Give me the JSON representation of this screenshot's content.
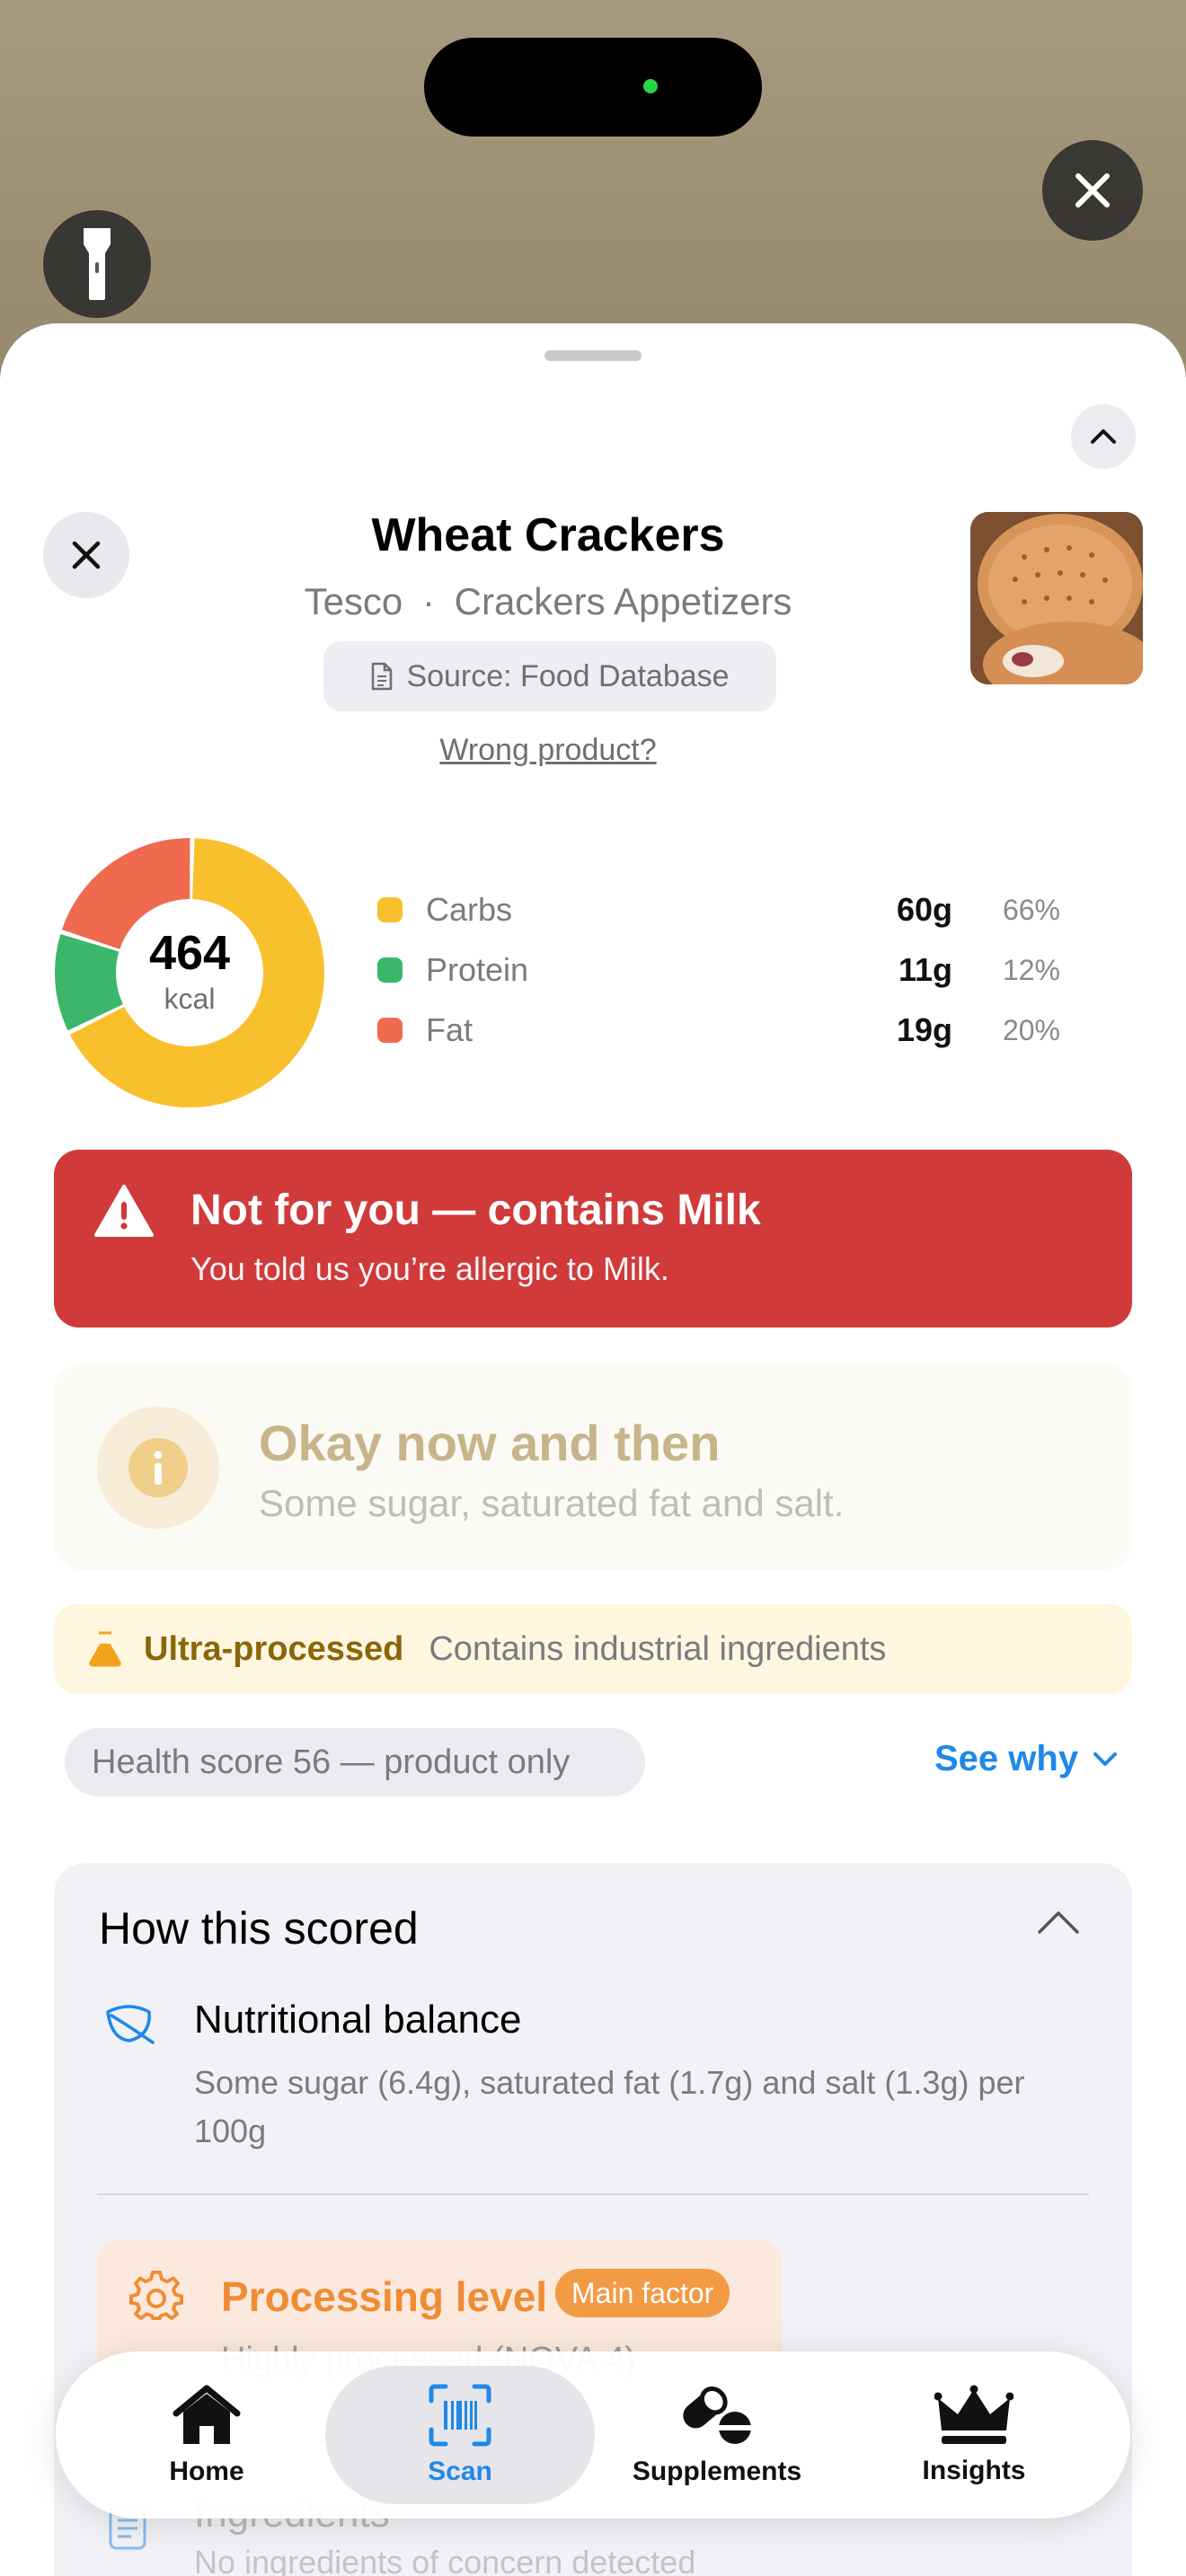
{
  "product": {
    "name": "Wheat Crackers",
    "brand": "Tesco",
    "separator": "·",
    "category": "Crackers Appetizers",
    "source": "Source: Food Database",
    "wrong_product": "Wrong product?"
  },
  "nutrition": {
    "kcal": "464",
    "kcal_unit": "kcal",
    "macros": [
      {
        "name": "Carbs",
        "grams": "60g",
        "percent": "66%",
        "fraction": 0.66,
        "color": "#f9c02e"
      },
      {
        "name": "Protein",
        "grams": "11g",
        "percent": "12%",
        "fraction": 0.12,
        "color": "#3cb66a"
      },
      {
        "name": "Fat",
        "grams": "19g",
        "percent": "20%",
        "fraction": 0.2,
        "color": "#ef6a4f"
      }
    ]
  },
  "allergy_alert": {
    "title": "Not for you — contains Milk",
    "subtitle": "You told us you’re allergic to Milk.",
    "color": "#d03a3b"
  },
  "verdict": {
    "title": "Okay now and then",
    "subtitle": "Some sugar, saturated fat and salt."
  },
  "processing_banner": {
    "label": "Ultra-processed",
    "description": "Contains industrial ingredients"
  },
  "health_score": {
    "label": "Health score 56 — product only",
    "see_why": "See why"
  },
  "how_scored": {
    "title": "How this scored",
    "items": [
      {
        "title": "Nutritional balance",
        "description": "Some sugar (6.4g), saturated fat (1.7g) and salt (1.3g) per 100g"
      },
      {
        "title": "Processing level",
        "badge": "Main factor",
        "description": "Highly processed (NOVA 4)"
      },
      {
        "title": "Ingredients",
        "description": "No ingredients of concern detected"
      }
    ]
  },
  "tabs": [
    {
      "label": "Home",
      "icon": "home-icon",
      "active": false
    },
    {
      "label": "Scan",
      "icon": "barcode-scan-icon",
      "active": true
    },
    {
      "label": "Supplements",
      "icon": "pill-icon",
      "active": false
    },
    {
      "label": "Insights",
      "icon": "crown-icon",
      "active": false
    }
  ],
  "accent_color": "#1f88e8"
}
